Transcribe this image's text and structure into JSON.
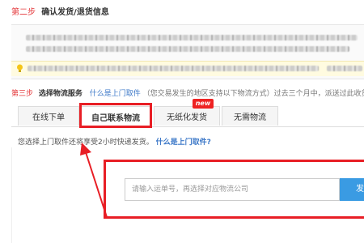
{
  "step2": {
    "num": "第二步",
    "title": "确认发货/退货信息"
  },
  "step3": {
    "num": "第三步",
    "title": "选择物流服务",
    "link": "什么是上门取件",
    "note": "（您交易发生的地区支持以下物流方式）过去三个月中，派送过此收货"
  },
  "tabs": [
    {
      "label": "在线下单",
      "active": false
    },
    {
      "label": "自己联系物流",
      "active": true
    },
    {
      "label": "无纸化发货",
      "active": false,
      "badge": "new"
    },
    {
      "label": "无需物流",
      "active": false
    }
  ],
  "info": {
    "text": "您选择上门取件还将享受2小时快递发货。",
    "link": "什么是上门取件?"
  },
  "tracking": {
    "placeholder": "请输入运单号，再选择对应物流公司",
    "value": "",
    "button_label": "发"
  },
  "colors": {
    "highlight": "#e81e25",
    "step_red": "#e4393c",
    "link_blue": "#3c78c8",
    "button_blue": "#3a9be3",
    "new_badge": "#e22222"
  },
  "icons": {
    "tip": "lightbulb-icon",
    "annotation": "red-arrow-annotation"
  }
}
